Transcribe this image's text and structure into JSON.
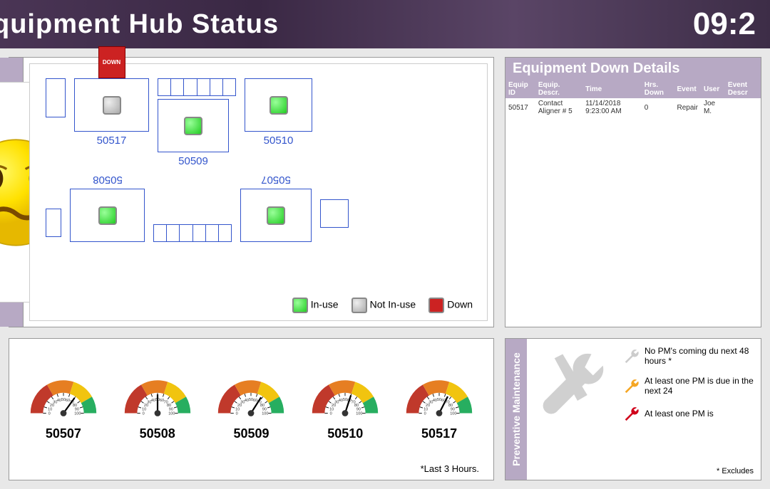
{
  "header": {
    "title": "quipment Hub Status",
    "time": "09:2"
  },
  "layout": {
    "top_row": [
      {
        "id": "50517",
        "status": "down",
        "light": "gray",
        "show_small_left": true
      },
      {
        "id": "50509",
        "status": "in-use",
        "light": "green",
        "show_slots": true
      },
      {
        "id": "50510",
        "status": "in-use",
        "light": "green"
      }
    ],
    "bottom_row": [
      {
        "id": "50508",
        "status": "in-use",
        "light": "green",
        "label_top": true,
        "show_small_left": true
      },
      {
        "id": "50507",
        "status": "in-use",
        "light": "green",
        "label_top": true,
        "show_slots": true,
        "show_sq_right": true
      }
    ]
  },
  "legend": {
    "in_use": "In-use",
    "not_in_use": "Not In-use",
    "down": "Down"
  },
  "details": {
    "title": "Equipment Down Details",
    "columns": [
      "Equip ID",
      "Equip. Descr.",
      "Time",
      "Hrs. Down",
      "Event",
      "User",
      "Event Descr"
    ],
    "rows": [
      {
        "equip_id": "50517",
        "descr": "Contact Aligner # 5",
        "time": "11/14/2018 9:23:00 AM",
        "hrs_down": "0",
        "event": "Repair",
        "user": "Joe M.",
        "event_descr": ""
      }
    ]
  },
  "gauges": {
    "items": [
      {
        "id": "50507",
        "value": 70
      },
      {
        "id": "50508",
        "value": 50
      },
      {
        "id": "50509",
        "value": 68
      },
      {
        "id": "50510",
        "value": 60
      },
      {
        "id": "50517",
        "value": 65
      }
    ],
    "note": "*Last 3 Hours."
  },
  "pm": {
    "side_label": "Preventive Maintenance",
    "rows": [
      {
        "color": "gray",
        "text": "No PM's coming du next 48 hours *"
      },
      {
        "color": "orange",
        "text": "At least one PM is due in the next 24"
      },
      {
        "color": "red",
        "text": "At least one PM is"
      }
    ],
    "note": "* Excludes"
  },
  "down_badge_label": "DOWN"
}
